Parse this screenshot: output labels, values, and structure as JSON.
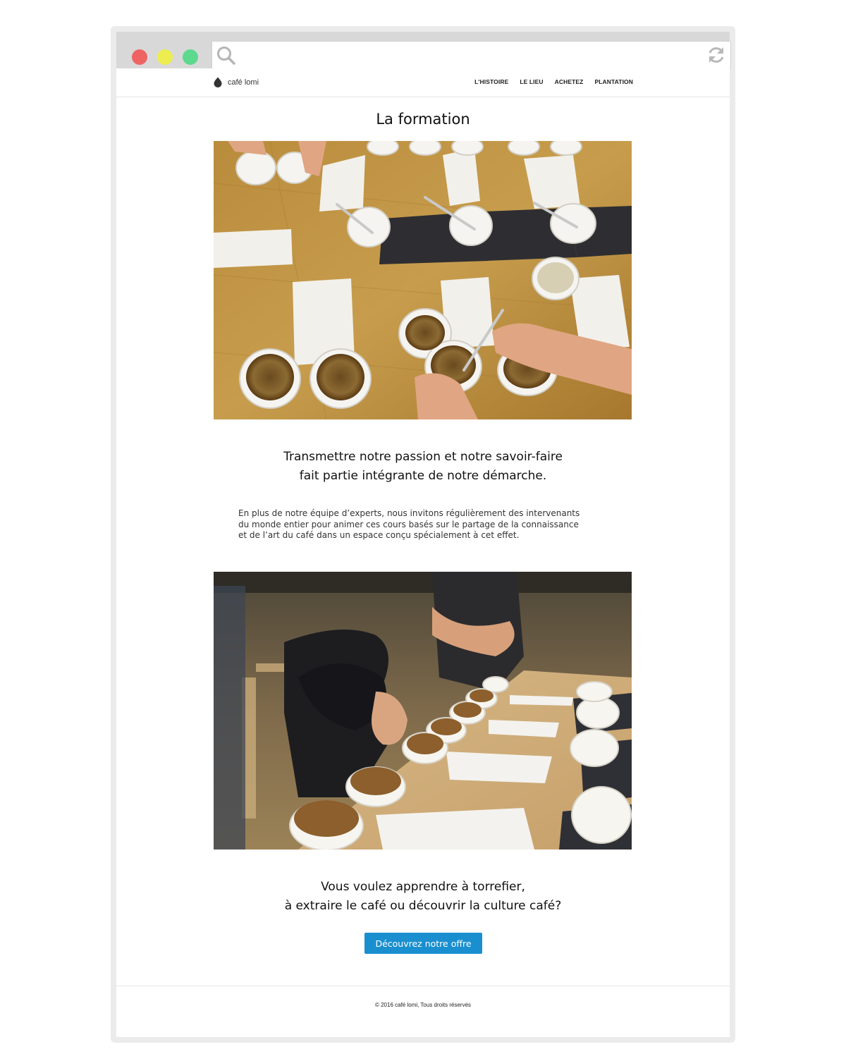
{
  "browser": {
    "url": "",
    "window_buttons": [
      "close",
      "minimize",
      "zoom"
    ],
    "icons": {
      "search": "search-icon",
      "refresh": "refresh-icon"
    }
  },
  "header": {
    "logo_text": "café lomi",
    "logo_icon": "coffee-bean-icon",
    "nav": [
      "L'HISTOIRE",
      "LE LIEU",
      "ACHETEZ",
      "PLANTATION"
    ]
  },
  "main": {
    "title": "La formation",
    "lead1": [
      "Transmettre notre passion et notre savoir-faire",
      "fait partie intégrante de notre démarche."
    ],
    "body": [
      "En plus de notre équipe d’experts, nous invitons régulièrement des intervenants",
      "du monde entier pour animer ces cours basés sur le partage de la connaissance",
      "et de l’art du café dans un espace conçu spécialement à cet effet."
    ],
    "lead2": [
      "Vous voulez apprendre à torrefier,",
      "à extraire le café ou découvrir la culture café?"
    ],
    "cta_label": "Découvrez notre offre"
  },
  "footer": {
    "copyright": "© 2016 café lomi, Tous droits réservés"
  },
  "colors": {
    "close": "#ee6463",
    "minimize": "#eded4f",
    "zoom": "#5dd98d",
    "cta": "#1a8fcf",
    "chrome": "#d8d8d8",
    "frame": "#ebebeb"
  }
}
